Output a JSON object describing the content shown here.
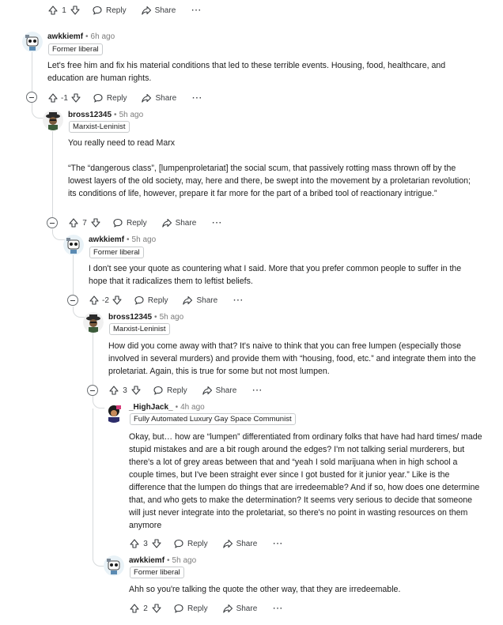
{
  "actions": {
    "reply_label": "Reply",
    "share_label": "Share",
    "more_label": "···"
  },
  "top": {
    "votes": "1"
  },
  "c1": {
    "username": "awkkiemf",
    "time": "6h ago",
    "flair": "Former liberal",
    "body": [
      "Let's free him and fix his material conditions that led to these terrible events. Housing, food, healthcare, and education are human rights."
    ],
    "votes": "-1"
  },
  "c2": {
    "username": "bross12345",
    "time": "5h ago",
    "flair": "Marxist-Leninist",
    "body": [
      "You really need to read Marx",
      "“The “dangerous class”, [lumpenproletariat] the social scum, that passively rotting mass thrown off by the lowest layers of the old society, may, here and there, be swept into the movement by a proletarian revolution; its conditions of life, however, prepare it far more for the part of a bribed tool of reactionary intrigue.”"
    ],
    "votes": "7"
  },
  "c3": {
    "username": "awkkiemf",
    "time": "5h ago",
    "flair": "Former liberal",
    "body": [
      "I don't see your quote as countering what I said. More that you prefer common people to suffer in the hope that it radicalizes them to leftist beliefs."
    ],
    "votes": "-2"
  },
  "c4": {
    "username": "bross12345",
    "time": "5h ago",
    "flair": "Marxist-Leninist",
    "body": [
      "How did you come away with that? It's naive to think that you can free lumpen (especially those involved in several murders) and provide them with “housing, food, etc.” and integrate them into the proletariat. Again, this is true for some but not most lumpen."
    ],
    "votes": "3"
  },
  "c5": {
    "username": "_HighJack_",
    "time": "4h ago",
    "flair": "Fully Automated Luxury Gay Space Communist",
    "body": [
      "Okay, but… how are “lumpen” differentiated from ordinary folks that have had hard times/ made stupid mistakes and are a bit rough around the edges? I'm not talking serial murderers, but there's a lot of grey areas between that and “yeah I sold marijuana when in high school a couple times, but I've been straight ever since I got busted for it junior year.” Like is the difference that the lumpen do things that are irredeemable? And if so, how does one determine that, and who gets to make the determination? It seems very serious to decide that someone will just never integrate into the proletariat, so there's no point in wasting resources on them anymore"
    ],
    "votes": "3"
  },
  "c6": {
    "username": "awkkiemf",
    "time": "5h ago",
    "flair": "Former liberal",
    "body": [
      "Ahh so you're talking the quote the other way, that they are irredeemable."
    ],
    "votes": "2"
  }
}
